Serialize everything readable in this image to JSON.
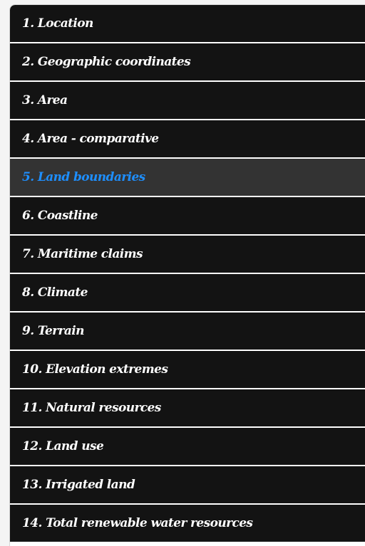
{
  "menu": {
    "active_index": 4,
    "active_color": "#1e8fff",
    "item_background": "#131313",
    "active_background": "#333333",
    "items": [
      {
        "label": "1. Location"
      },
      {
        "label": "2. Geographic coordinates"
      },
      {
        "label": "3. Area"
      },
      {
        "label": "4. Area - comparative"
      },
      {
        "label": "5. Land boundaries"
      },
      {
        "label": "6. Coastline"
      },
      {
        "label": "7. Maritime claims"
      },
      {
        "label": "8. Climate"
      },
      {
        "label": "9. Terrain"
      },
      {
        "label": "10. Elevation extremes"
      },
      {
        "label": "11. Natural resources"
      },
      {
        "label": "12. Land use"
      },
      {
        "label": "13. Irrigated land"
      },
      {
        "label": "14. Total renewable water resources"
      }
    ]
  }
}
